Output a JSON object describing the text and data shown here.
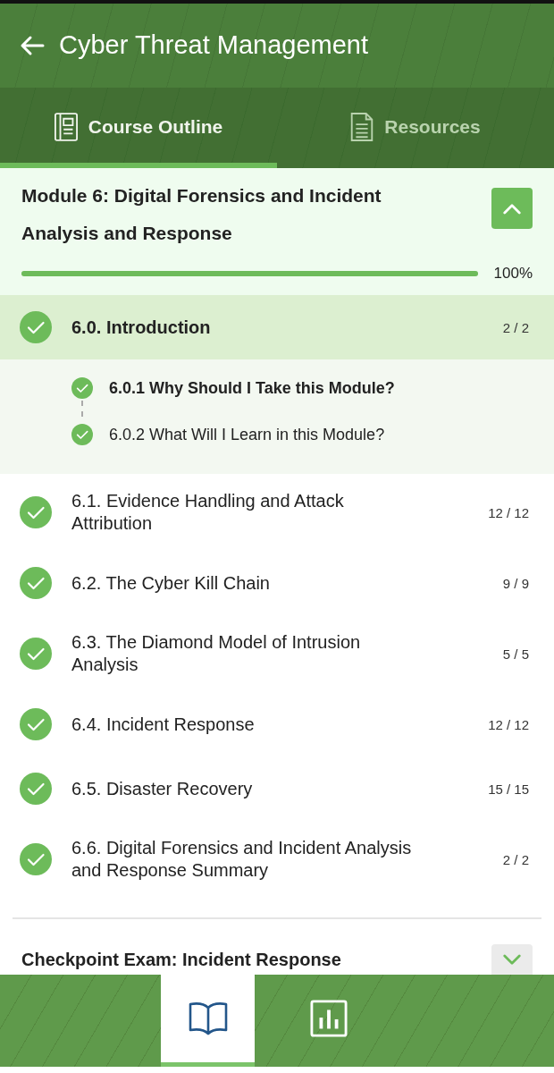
{
  "header": {
    "title": "Cyber Threat Management"
  },
  "tabs": [
    {
      "label": "Course Outline",
      "kind": "outline",
      "selected": true
    },
    {
      "label": "Resources",
      "kind": "document",
      "selected": false
    }
  ],
  "module": {
    "title": "Module 6: Digital Forensics and Incident Analysis and Response",
    "expanded": true,
    "level": 1,
    "percent": "100%"
  },
  "lessons": [
    {
      "title": "6.0. Introduction",
      "count": "2 / 2",
      "completed": true,
      "selected": true,
      "expanded": true,
      "children": [
        {
          "title": "6.0.1 Why Should I Take this Module?",
          "completed": true,
          "selected": true
        },
        {
          "title": "6.0.2 What Will I Learn in this Module?",
          "completed": true,
          "selected": false
        }
      ]
    },
    {
      "title": "6.1. Evidence Handling and Attack Attribution",
      "count": "12 / 12",
      "completed": true,
      "selected": false,
      "expanded": false
    },
    {
      "title": "6.2. The Cyber Kill Chain",
      "count": "9 / 9",
      "completed": true,
      "selected": false,
      "expanded": false
    },
    {
      "title": "6.3. The Diamond Model of Intrusion Analysis",
      "count": "5 / 5",
      "completed": true,
      "selected": false,
      "expanded": false
    },
    {
      "title": "6.4. Incident Response",
      "count": "12 / 12",
      "completed": true,
      "selected": false,
      "expanded": false
    },
    {
      "title": "6.5. Disaster Recovery",
      "count": "15 / 15",
      "completed": true,
      "selected": false,
      "expanded": false
    },
    {
      "title": "6.6. Digital Forensics and Incident Analysis and Response Summary",
      "count": "2 / 2",
      "completed": true,
      "selected": false,
      "expanded": false
    }
  ],
  "next_module": {
    "title": "Checkpoint Exam: Incident Response",
    "expanded": false
  },
  "bottom_nav": [
    {
      "kind": "book",
      "selected": true
    },
    {
      "kind": "chart",
      "selected": false
    }
  ]
}
